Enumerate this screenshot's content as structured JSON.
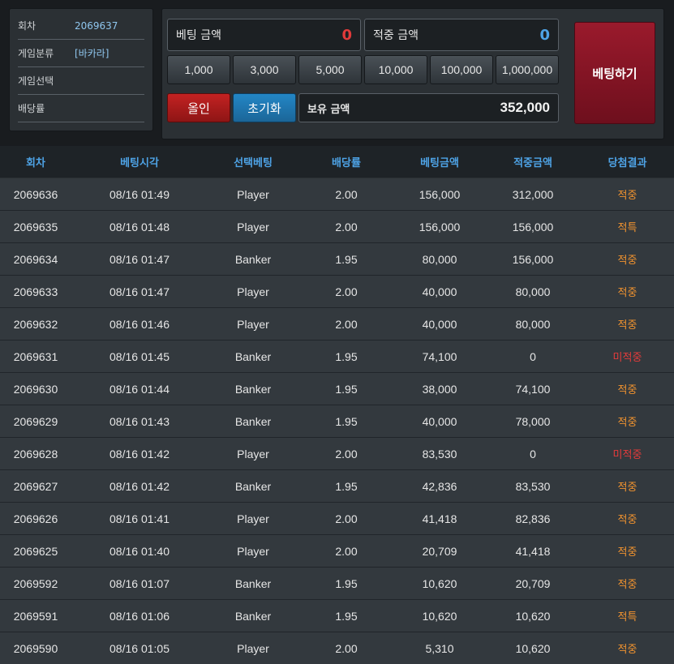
{
  "info": {
    "round_label": "회차",
    "round_value": "2069637",
    "category_label": "게임분류",
    "category_value": "[바카라]",
    "selection_label": "게임선택",
    "selection_value": "",
    "odds_label": "배당률",
    "odds_value": ""
  },
  "bet": {
    "bet_amount_label": "베팅 금액",
    "bet_amount_value": "0",
    "win_amount_label": "적중 금액",
    "win_amount_value": "0",
    "chips": [
      "1,000",
      "3,000",
      "5,000",
      "10,000",
      "100,000",
      "1,000,000"
    ],
    "allin_label": "올인",
    "reset_label": "초기화",
    "balance_label": "보유 금액",
    "balance_value": "352,000",
    "submit_label": "베팅하기"
  },
  "table": {
    "headers": [
      "회차",
      "베팅시각",
      "선택베팅",
      "배당률",
      "베팅금액",
      "적중금액",
      "당첨결과"
    ],
    "rows": [
      [
        "2069636",
        "08/16 01:49",
        "Player",
        "2.00",
        "156,000",
        "312,000",
        "적중"
      ],
      [
        "2069635",
        "08/16 01:48",
        "Player",
        "2.00",
        "156,000",
        "156,000",
        "적특"
      ],
      [
        "2069634",
        "08/16 01:47",
        "Banker",
        "1.95",
        "80,000",
        "156,000",
        "적중"
      ],
      [
        "2069633",
        "08/16 01:47",
        "Player",
        "2.00",
        "40,000",
        "80,000",
        "적중"
      ],
      [
        "2069632",
        "08/16 01:46",
        "Player",
        "2.00",
        "40,000",
        "80,000",
        "적중"
      ],
      [
        "2069631",
        "08/16 01:45",
        "Banker",
        "1.95",
        "74,100",
        "0",
        "미적중"
      ],
      [
        "2069630",
        "08/16 01:44",
        "Banker",
        "1.95",
        "38,000",
        "74,100",
        "적중"
      ],
      [
        "2069629",
        "08/16 01:43",
        "Banker",
        "1.95",
        "40,000",
        "78,000",
        "적중"
      ],
      [
        "2069628",
        "08/16 01:42",
        "Player",
        "2.00",
        "83,530",
        "0",
        "미적중"
      ],
      [
        "2069627",
        "08/16 01:42",
        "Banker",
        "1.95",
        "42,836",
        "83,530",
        "적중"
      ],
      [
        "2069626",
        "08/16 01:41",
        "Player",
        "2.00",
        "41,418",
        "82,836",
        "적중"
      ],
      [
        "2069625",
        "08/16 01:40",
        "Player",
        "2.00",
        "20,709",
        "41,418",
        "적중"
      ],
      [
        "2069592",
        "08/16 01:07",
        "Banker",
        "1.95",
        "10,620",
        "20,709",
        "적중"
      ],
      [
        "2069591",
        "08/16 01:06",
        "Banker",
        "1.95",
        "10,620",
        "10,620",
        "적특"
      ],
      [
        "2069590",
        "08/16 01:05",
        "Player",
        "2.00",
        "5,310",
        "10,620",
        "적중"
      ]
    ]
  },
  "colors": {
    "header_text": "#4ea3e6",
    "result_win": "#f1932f",
    "result_lose": "#e53b3b"
  }
}
